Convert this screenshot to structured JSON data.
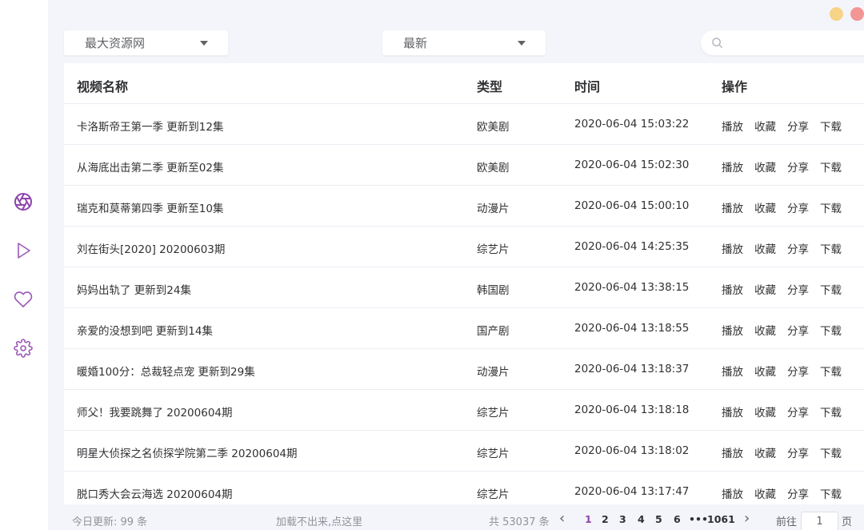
{
  "window": {
    "minimize_color": "#f6d488",
    "close_color": "#f29595"
  },
  "theme": {
    "accent": "#8e44ad",
    "icon": "#9b59b6"
  },
  "sidebar": {
    "items": [
      {
        "name": "aperture-icon",
        "active": true
      },
      {
        "name": "play-icon"
      },
      {
        "name": "heart-icon"
      },
      {
        "name": "settings-icon"
      }
    ]
  },
  "filters": {
    "source": "最大资源网",
    "sort": "最新"
  },
  "search": {
    "value": ""
  },
  "table": {
    "headers": {
      "name": "视频名称",
      "type": "类型",
      "time": "时间",
      "actions": "操作"
    },
    "action_labels": {
      "play": "播放",
      "fav": "收藏",
      "share": "分享",
      "download": "下载"
    },
    "rows": [
      {
        "name": "卡洛斯帝王第一季 更新到12集",
        "type": "欧美剧",
        "time": "2020-06-04 15:03:22"
      },
      {
        "name": "从海底出击第二季 更新至02集",
        "type": "欧美剧",
        "time": "2020-06-04 15:02:30"
      },
      {
        "name": "瑞克和莫蒂第四季 更新至10集",
        "type": "动漫片",
        "time": "2020-06-04 15:00:10"
      },
      {
        "name": "刘在街头[2020] 20200603期",
        "type": "综艺片",
        "time": "2020-06-04 14:25:35"
      },
      {
        "name": "妈妈出轨了 更新到24集",
        "type": "韩国剧",
        "time": "2020-06-04 13:38:15"
      },
      {
        "name": "亲爱的没想到吧 更新到14集",
        "type": "国产剧",
        "time": "2020-06-04 13:18:55"
      },
      {
        "name": "暖婚100分：总裁轻点宠 更新到29集",
        "type": "动漫片",
        "time": "2020-06-04 13:18:37"
      },
      {
        "name": "师父！我要跳舞了 20200604期",
        "type": "综艺片",
        "time": "2020-06-04 13:18:18"
      },
      {
        "name": "明星大侦探之名侦探学院第二季 20200604期",
        "type": "综艺片",
        "time": "2020-06-04 13:18:02"
      },
      {
        "name": "脱口秀大会云海选 20200604期",
        "type": "综艺片",
        "time": "2020-06-04 13:17:47"
      }
    ]
  },
  "footer": {
    "today_update": "今日更新: 99 条",
    "fallback_link": "加载不出来,点这里",
    "total": "共 53037 条",
    "prev": "‹",
    "next": "›",
    "pages": [
      "1",
      "2",
      "3",
      "4",
      "5",
      "6",
      "•••",
      "1061"
    ],
    "current_page": "1",
    "goto_label": "前往",
    "goto_value": "1",
    "goto_unit": "页"
  }
}
